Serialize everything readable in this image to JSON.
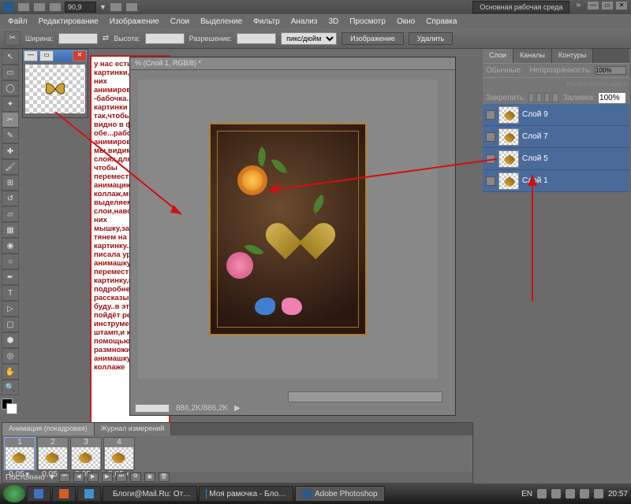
{
  "titlebar": {
    "zoom": "90,9",
    "workspace_btn": "Основная рабочая среда"
  },
  "menu": {
    "file": "Файл",
    "edit": "Редактирование",
    "image": "Изображение",
    "layers": "Слои",
    "select": "Выделение",
    "filter": "Фильтр",
    "analysis": "Анализ",
    "threed": "3D",
    "view": "Просмотр",
    "window": "Окно",
    "help": "Справка"
  },
  "options": {
    "width_lbl": "Ширина:",
    "height_lbl": "Высота:",
    "res_lbl": "Разрешение:",
    "units": "пикс/дюйм",
    "btn_image": "Изображение",
    "btn_delete": "Удалить",
    "width": "",
    "height": "",
    "res": ""
  },
  "doc": {
    "tab": "% (Слой 1, RGB/8) *",
    "zoom": "",
    "status": "886,2K/886,2K"
  },
  "callout_text": "у нас есть две картинки,одна из них анимированная -бабочка..ставим картинки так,чтобы их было видно в фотошопе обе...рабочая у нас анимированная,её мы видим в слоях,для того чтобы переместить анимацию на коллаж,мы в слоях выделяем все слои,наводим на них мышку,зажимаем и тянем на нашу картинку...я уже писала урок, как анимашку переместить на картинку,поэтому подробнее рассказывать не буду..в этом уроке пойдёт речь о инструменте штамп,и как с его помощью размножить анимашку на коллаже",
  "panels": {
    "tab_layers": "Слои",
    "tab_channels": "Каналы",
    "tab_paths": "Контуры",
    "blend_lbl": "Обычные",
    "opacity_lbl": "Непрозрачность:",
    "opacity_val": "100%",
    "lock_lbl": "Закрепить:",
    "spread_lbl": "Распространить кадр 1",
    "fill_lbl": "Заливка:",
    "fill_val": "100%",
    "layers": [
      {
        "name": "Слой 9"
      },
      {
        "name": "Слой 7"
      },
      {
        "name": "Слой 5"
      },
      {
        "name": "Слой 1"
      }
    ]
  },
  "animation": {
    "tab_frames": "Анимация (покадровая)",
    "tab_log": "Журнал измерений",
    "loop": "Постоянно",
    "frames": [
      {
        "n": "1",
        "d": "0,05"
      },
      {
        "n": "2",
        "d": "0,05"
      },
      {
        "n": "3",
        "d": "0,05"
      },
      {
        "n": "4",
        "d": "0,05"
      }
    ]
  },
  "taskbar": {
    "task1": "Блоги@Mail.Ru: От…",
    "task2": "Моя рамочка - Бло…",
    "task3": "Adobe Photoshop",
    "lang": "EN",
    "time": "20:57"
  }
}
